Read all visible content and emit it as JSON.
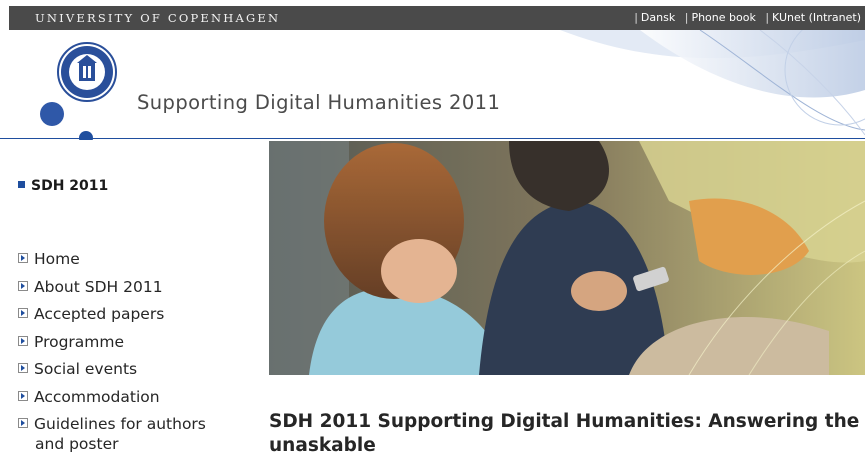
{
  "topbar": {
    "university": "UNIVERSITY OF COPENHAGEN",
    "links": [
      "Dansk",
      "Phone book",
      "KUnet (Intranet)"
    ]
  },
  "header": {
    "site_title": "Supporting Digital Humanities 2011",
    "seal_icon": "university-seal-icon",
    "accent_color": "#1f4e9e"
  },
  "sidebar": {
    "section_title": "SDH 2011",
    "items": [
      {
        "label": "Home"
      },
      {
        "label": "About SDH 2011"
      },
      {
        "label": "Accepted papers"
      },
      {
        "label": "Programme"
      },
      {
        "label": "Social events"
      },
      {
        "label": "Accommodation"
      },
      {
        "label": "Guidelines for authors",
        "label2": "and poster"
      }
    ]
  },
  "main": {
    "heading": "SDH 2011 Supporting Digital Humanities: Answering the unaskable"
  }
}
